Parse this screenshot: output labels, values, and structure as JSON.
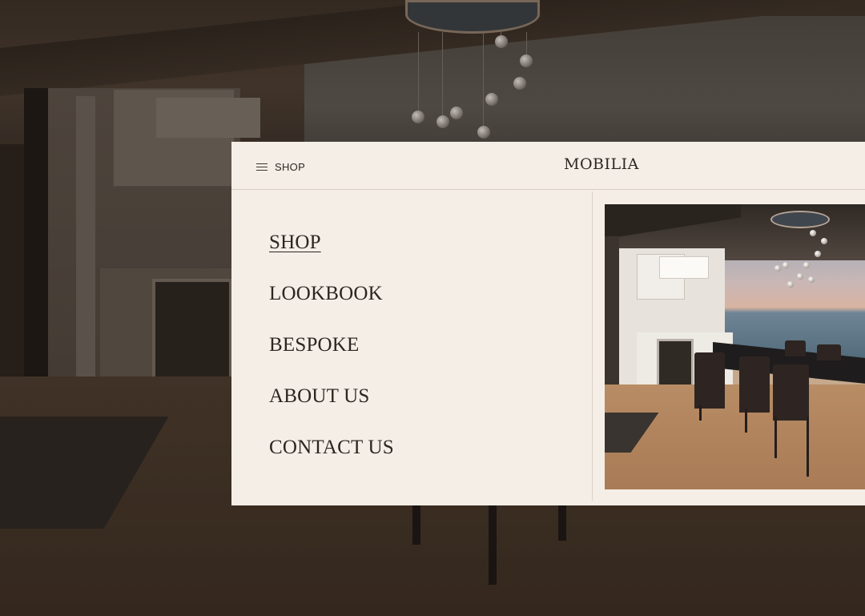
{
  "header": {
    "shop_label": "SHOP",
    "brand": "MOBILIA"
  },
  "menu": {
    "items": [
      {
        "label": "SHOP",
        "active": true
      },
      {
        "label": "LOOKBOOK",
        "active": false
      },
      {
        "label": "BESPOKE",
        "active": false
      },
      {
        "label": "ABOUT US",
        "active": false
      },
      {
        "label": "CONTACT US",
        "active": false
      }
    ]
  },
  "icons": {
    "menu_toggle": "hamburger-icon"
  },
  "colors": {
    "panel_bg": "#f5eee6",
    "text": "#2b2622",
    "divider": "#d6cdc3"
  }
}
